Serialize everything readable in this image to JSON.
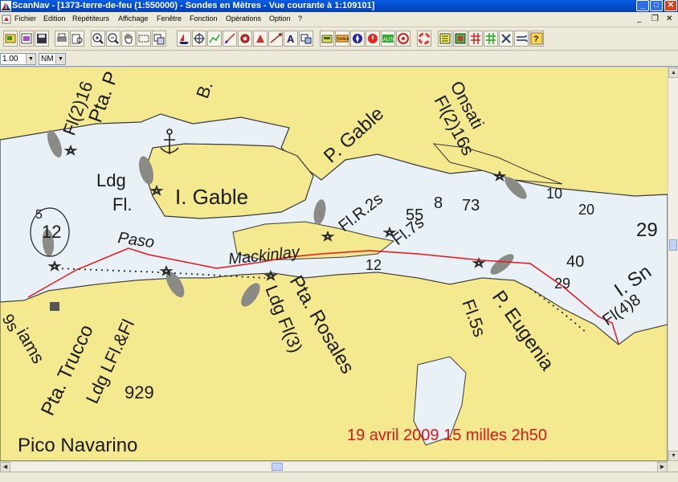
{
  "window": {
    "title": "ScanNav - [1373-terre-de-feu (1:550000) - Sondes en  Mètres  - Vue courante à 1:109101]",
    "min_symbol": "_",
    "max_symbol": "□",
    "close_symbol": "✕"
  },
  "menu": {
    "items": [
      "Fichier",
      "Edition",
      "Répétiteurs",
      "Affichage",
      "Fenêtre",
      "Fonction",
      "Opérations",
      "Option",
      "?"
    ],
    "mdi_min": "_",
    "mdi_restore": "❐",
    "mdi_close": "✕"
  },
  "status_row": {
    "scale_value": "1.00",
    "unit_value": "NM"
  },
  "chart": {
    "labels": {
      "fl2_16": "Fl(2)16",
      "pta_p": "Pta. P",
      "b": "B.",
      "p_gable": "P. Gable",
      "onsati": "Onsati",
      "fl2_16s": "Fl(2)16s",
      "ldg": "Ldg",
      "fl": "Fl.",
      "i_gable": "I. Gable",
      "flr2s": "Fl.R.2s",
      "d55": "55",
      "d8": "8",
      "d73": "73",
      "d10": "10",
      "d20": "20",
      "d29": "29",
      "d5": "5",
      "d12": "12",
      "paso": "Paso",
      "mackinlay": "Mackinlay",
      "fl7s": "Fl.7s",
      "d40": "40",
      "i_sn": "I. Sn",
      "d29b": "29",
      "fl4_8": "Fl(4)8",
      "d12b": "12",
      "iams": "iams",
      "s9": "9s",
      "pta_trucco": "Pta. Trucco",
      "ldg_lfl_fl": "Ldg LFl.&Fl",
      "pta_rosales": "Pta. Rosales",
      "ldg_fl3": "Ldg Fl(3)",
      "p_eugenia": "P. Eugenia",
      "fl5s": "Fl.5s",
      "d929": "929",
      "pico_navarino": "Pico Navarino",
      "log_entry": "19 avril 2009 15 milles 2h50"
    },
    "colors": {
      "land": "#f4e98e",
      "water": "#e9f1f7",
      "track": "#e8141c",
      "annotation": "#e0141a"
    }
  },
  "statusbar": {
    "text": ""
  }
}
